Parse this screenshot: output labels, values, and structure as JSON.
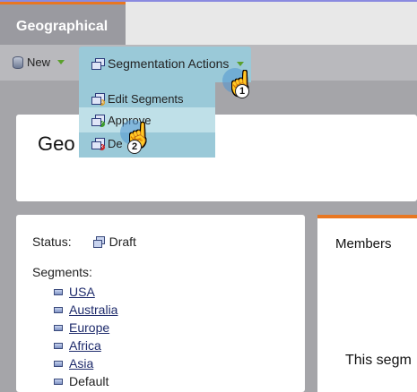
{
  "header": {
    "tab_label": "Geographical"
  },
  "toolbar": {
    "new_label": "New"
  },
  "menu": {
    "title": "Segmentation Actions",
    "items": [
      {
        "label": "Edit Segments"
      },
      {
        "label": "Approve"
      },
      {
        "label": "De"
      }
    ]
  },
  "page": {
    "title": "Geo"
  },
  "details": {
    "status_label": "Status:",
    "status_value": "Draft",
    "segments_label": "Segments:",
    "segments": [
      "USA",
      "Australia",
      "Europe",
      "Africa",
      "Asia",
      "Default"
    ]
  },
  "members": {
    "label": "Members",
    "body_text": "This segm"
  },
  "cursors": [
    {
      "badge": "1"
    },
    {
      "badge": "2"
    }
  ],
  "colors": {
    "accent": "#e87722",
    "menu_bg": "#9ac9d8",
    "link": "#1d2a6b"
  }
}
